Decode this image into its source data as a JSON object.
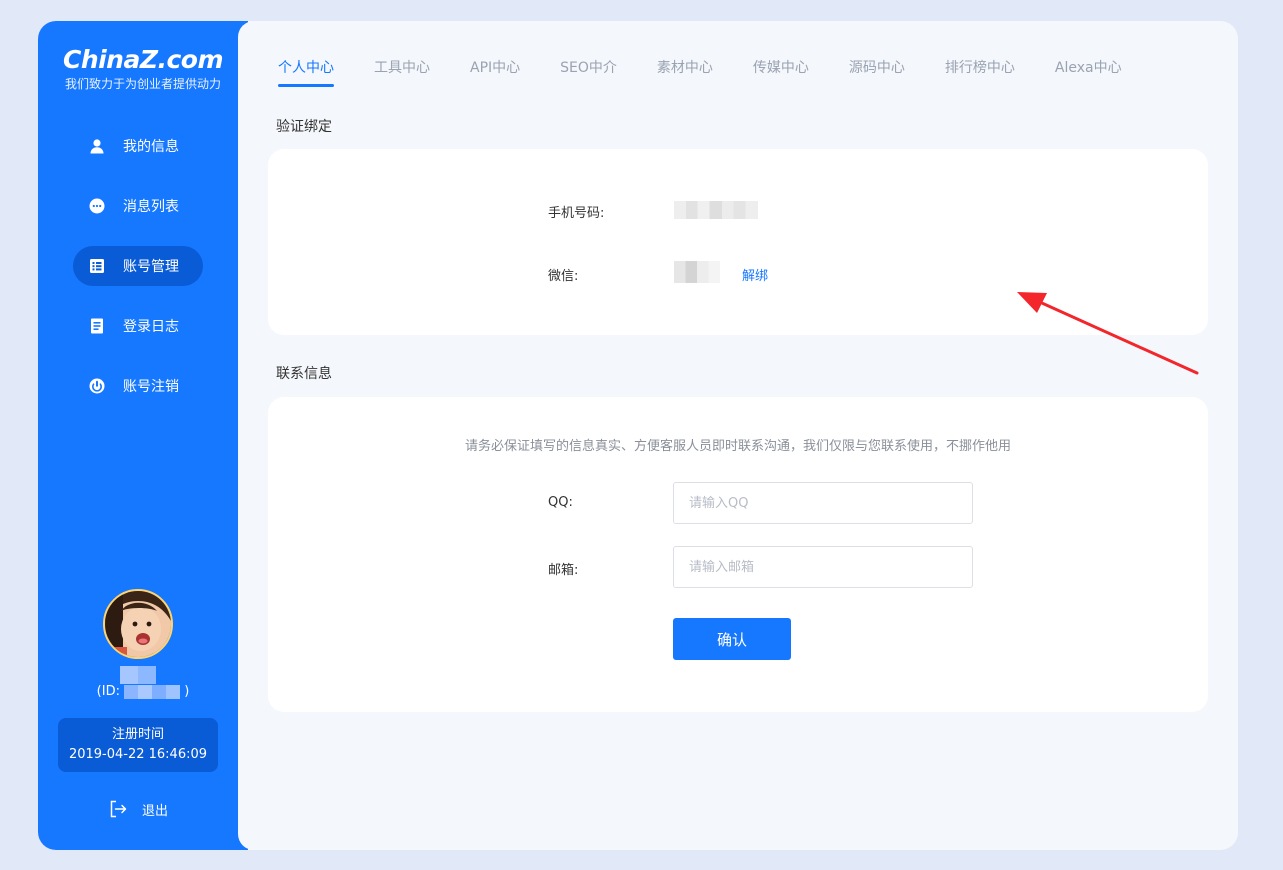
{
  "brand": {
    "logo_text": "ChinaZ.com",
    "slogan": "我们致力于为创业者提供动力",
    "primary_color": "#1677ff",
    "active_color": "#0a5bd6"
  },
  "sidebar": {
    "items": [
      {
        "label": "我的信息",
        "icon": "user-icon"
      },
      {
        "label": "消息列表",
        "icon": "chat-bubble-icon"
      },
      {
        "label": "账号管理",
        "icon": "list-icon",
        "active": true
      },
      {
        "label": "登录日志",
        "icon": "document-icon"
      },
      {
        "label": "账号注销",
        "icon": "power-icon"
      }
    ],
    "user": {
      "id_prefix": "(ID:",
      "id_suffix": ")"
    },
    "register": {
      "label": "注册时间",
      "time": "2019-04-22 16:46:09"
    },
    "logout_label": "退出"
  },
  "tabs": [
    {
      "label": "个人中心",
      "active": true
    },
    {
      "label": "工具中心"
    },
    {
      "label": "API中心"
    },
    {
      "label": "SEO中介"
    },
    {
      "label": "素材中心"
    },
    {
      "label": "传媒中心"
    },
    {
      "label": "源码中心"
    },
    {
      "label": "排行榜中心"
    },
    {
      "label": "Alexa中心"
    }
  ],
  "verify": {
    "title": "验证绑定",
    "phone_label": "手机号码:",
    "wechat_label": "微信:",
    "unbind_label": "解绑"
  },
  "contact": {
    "title": "联系信息",
    "notice": "请务必保证填写的信息真实、方便客服人员即时联系沟通，我们仅限与您联系使用，不挪作他用",
    "qq_label": "QQ:",
    "qq_placeholder": "请输入QQ",
    "email_label": "邮箱:",
    "email_placeholder": "请输入邮箱",
    "confirm_label": "确认"
  }
}
